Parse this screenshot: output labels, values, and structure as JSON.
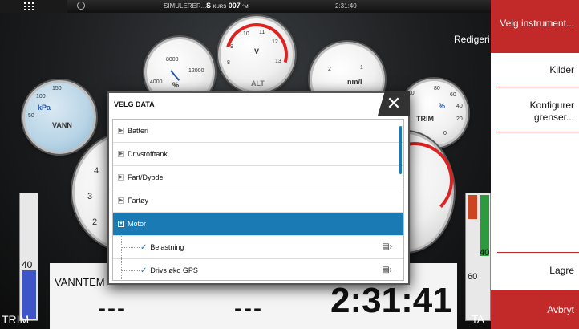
{
  "statusbar": {
    "sim_label": "SIMULERER...",
    "kurs_prefix": "S",
    "kurs_label": "KURS",
    "kurs_value": "007",
    "kurs_unit": "°M",
    "time": "2:31:40"
  },
  "dashboard": {
    "edit_label": "Redigeri",
    "gauges": {
      "kpa": {
        "unit": "kPa",
        "label": "VANN",
        "ticks": [
          "100",
          "150",
          "50"
        ]
      },
      "pct": {
        "ticks": [
          "8000",
          "12000",
          "4000",
          "%"
        ]
      },
      "volt": {
        "unit": "V",
        "label": "ALT",
        "ticks": [
          "9",
          "10",
          "11",
          "12",
          "13",
          "8"
        ]
      },
      "nm": {
        "unit": "nm/l",
        "ticks": [
          "2",
          "1"
        ]
      },
      "trim_gauge": {
        "unit": "%",
        "label": "TRIM",
        "ticks": [
          "100",
          "80",
          "60",
          "40",
          "20",
          "0"
        ]
      },
      "rpm_left_ticks": [
        "4",
        "3",
        "2"
      ]
    },
    "trim_left": {
      "value": "40",
      "label": "TRIM",
      "fraction": 0.4
    },
    "trim_right": {
      "v40": "40",
      "v60": "60",
      "label": "TA"
    },
    "data_panel": {
      "header": "VANNTEM",
      "value1": "---",
      "value2": "---",
      "clock": "2:31:41"
    }
  },
  "modal": {
    "title": "VELG DATA",
    "close_glyph": "✕",
    "items": [
      {
        "label": "Batteri",
        "expanded": false
      },
      {
        "label": "Drivstofftank",
        "expanded": false
      },
      {
        "label": "Fart/Dybde",
        "expanded": false
      },
      {
        "label": "Fartøy",
        "expanded": false
      },
      {
        "label": "Motor",
        "expanded": true,
        "selected": true
      }
    ],
    "subitems": [
      {
        "label": "Belastning",
        "checked": true,
        "icon": "options-icon"
      },
      {
        "label": "Drivs øko GPS",
        "checked": true,
        "icon": "options-icon"
      }
    ]
  },
  "menu": {
    "title": "Velg instrument...",
    "source": "Kilder",
    "configure": "Konfigurer grenser...",
    "save": "Lagre",
    "cancel": "Avbryt",
    "accent": "#c22a2a"
  }
}
